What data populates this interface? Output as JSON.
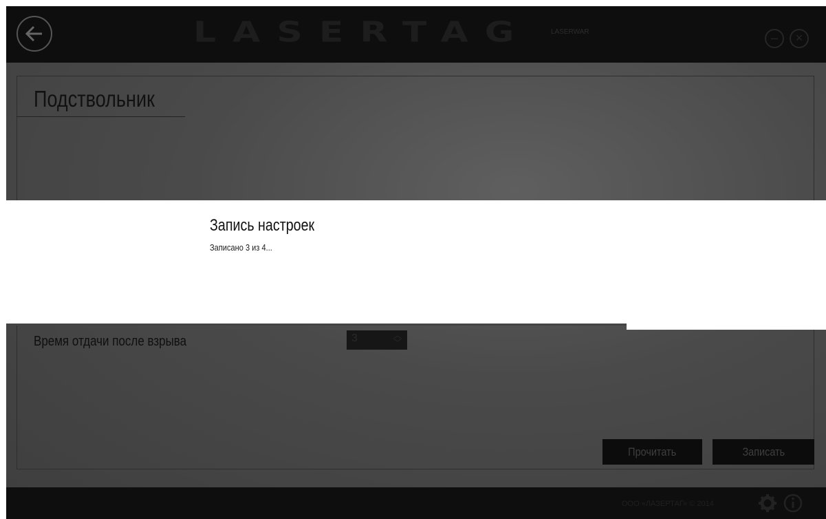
{
  "header": {
    "logo_text": "LASERTAG",
    "logo_sub": "LASERWAR",
    "back_icon": "arrow-left-icon",
    "minimize_icon": "minimize-icon",
    "close_icon": "close-icon"
  },
  "page": {
    "title": "Подствольник",
    "setting_label": "Время отдачи после взрыва",
    "setting_value": "3"
  },
  "buttons": {
    "read_label": "Прочитать",
    "write_label": "Записать"
  },
  "footer": {
    "copyright": "ООО «ЛАЗЕРТАГ» © 2014",
    "settings_icon": "gear-icon",
    "info_icon": "info-icon"
  },
  "modal": {
    "title": "Запись настроек",
    "status": "Записано 3 из 4..."
  },
  "colors": {
    "dim_background": "#4a4a4a",
    "bar_background": "#0e0e0e",
    "modal_background": "#ffffff"
  }
}
